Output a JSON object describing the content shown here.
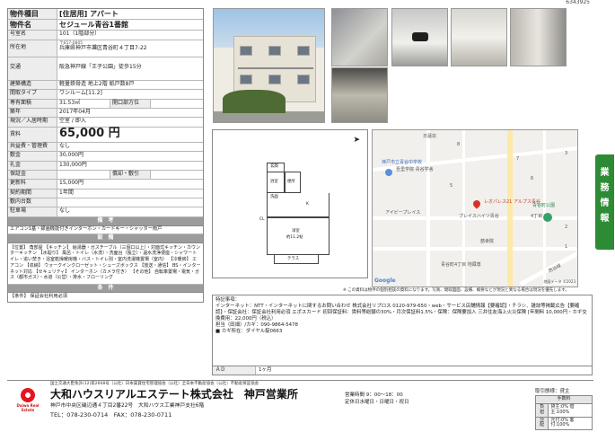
{
  "page_id": "6343925",
  "spec": {
    "type_label": "物件種目",
    "type_value": "[住居用] アパート",
    "name_label": "物件名",
    "name_value": "セジュール青谷1番館",
    "room_label": "号室名",
    "room_value": "101（1階部分）",
    "address_label": "所在地",
    "postal": "〒657-0805",
    "address_value": "兵庫県神戸市灘区青谷町４丁目7-22",
    "access_label": "交通",
    "access_value": "阪急神戸線「王子公園」徒歩15分",
    "structure_label": "建築構造",
    "structure_value": "軽量鉄骨造 地上2階 紙戸数8戸",
    "layout_label": "間取タイプ",
    "layout_value": "ワンルーム[11.2]",
    "area_label": "専有面積",
    "area_value": "31.53㎡",
    "opening_label": "開口部方位",
    "opening_value": "",
    "built_label": "築年",
    "built_value": "2017年04月",
    "status_label": "現況／入居時期",
    "status_value": "空室 / 即入",
    "rent_label": "賃料",
    "rent_value": "65,000 円",
    "common_label": "共益費・管理費",
    "common_value": "なし",
    "deposit_label": "敷金",
    "deposit_value": "30,000円",
    "key_label": "礼金",
    "key_value": "130,000円",
    "guarantee_label": "保証金",
    "guarantee_value": "",
    "amortize_label": "償却・敷引",
    "amortize_value": "",
    "renewal_label": "更新料",
    "renewal_value": "15,000円",
    "term_label": "契約期間",
    "term_value": "1年間",
    "parking_in_label": "敷内台数",
    "parking_in_value": "",
    "parking_label": "駐車場",
    "parking_value": "なし",
    "remarks_band": "備　考",
    "remarks_text": "エアコン1基・録画機能付きインターホン・カードキー・シャッター雨戸",
    "equipment_band": "設　備",
    "equipment_text": "【位置】 角部屋 【キッチン】 給湯器・ガスチーブル（三個口以上）・対面式キッチン・カウンターキッチン 【水廻り】 風呂・トイレ（水洗）・洗面台（独立）・温水洗浄便座・シャワートイレ・追い焚き・浴室乾燥暖房機・バス・トイレ別・室内洗濯機置場（室内） 【冷暖房】 エアコン 【収納】 ウォークインクローゼット・シューズボックス 【放送・通信】 BS・インターネット対応 【セキュリティ】 インターホン（カメラ付き） 【その他】 自転車置場・電気・ガス（都市ガス）・水道（公営）・排水・フローリング",
    "conditions_band": "条　件",
    "conditions_text": "【条件】 保証会社利用必須"
  },
  "plan": {
    "entry": "玄関",
    "kitchen": "K",
    "wash": "洗面",
    "wc": "便所",
    "bath": "浴室",
    "main_room": "洋室",
    "main_room_size": "約11.2帖",
    "terrace": "テラス",
    "closet": "CL"
  },
  "map": {
    "labels": {
      "school": "神戸市立青谷中学校",
      "school2": "吾里学院 青谷学舎",
      "ivy": "アイビープレイス",
      "place": "プレイスハイツ青谷",
      "target": "レオパレス21 アルプス青谷",
      "park": "青谷町公園",
      "block": "4丁目",
      "bridge": "日蓮宗",
      "temple": "慈幸院",
      "park2": "青谷町4丁目 地蔵尊",
      "road": "西谷線",
      "num1": "1",
      "num2": "2",
      "num3": "3",
      "num5": "5",
      "num6": "6",
      "num7": "7",
      "num8": "8"
    },
    "google": "Google",
    "copyright": "地図データ ©2023"
  },
  "side_tab": "業務情報",
  "disclaimer": "※ この資料は物件の個別相談の資料になります。写真、間取図面、設備、概要などが現況と異なる場合は現況を優先します。",
  "remarks": {
    "label": "特記事項：",
    "text": "インターネット：NTT・インターネットに関するお問い合わせ 株式会社リブロス 0120-979-650・web・サービス店舗情報【要確認】・チラシ、雑誌等掲載広告【要確認】・保証会社：保証会社利用必須 エポスカード 初回保証料：賃料等総額の30%・月次保証料1.5%・保険：保険要加入 三井住友海上火災保険 [年間料 10,000円・カギ交換費用：22,000円（税込）",
    "managed": "担当（田畑）/カギ：090-9864-5478",
    "key": "■ カギ所在：ダイヤル錠0663"
  },
  "ad": {
    "label": "ＡＤ",
    "value": "1ヶ月"
  },
  "footer": {
    "assoc": "国土交通大臣免許(12)第2608号（公社）日本賃貸住宅管理協会（公社）全日本不動産協会（公社）不動産保証協会",
    "logo_text": "Daiwa Real Estate",
    "company": "大和ハウスリアルエステート株式会社　神戸営業所",
    "address": "神戸市中央区磯辺通４丁目2番22号　大和ハウス工業神戸支社6階",
    "tel": "TEL：078-230-0714　FAX：078-230-0711",
    "hours": "営業時間 9：00～18：00",
    "holiday": "定休日水曜日・日曜日・祝日",
    "deal_label": "取引態様：貸主",
    "fee_label": "手数料",
    "burden_label": "負担",
    "burden_value": "貸主:0% 借主:100%",
    "split_label": "分配",
    "split_value": "元付:0% 客付:100%"
  }
}
